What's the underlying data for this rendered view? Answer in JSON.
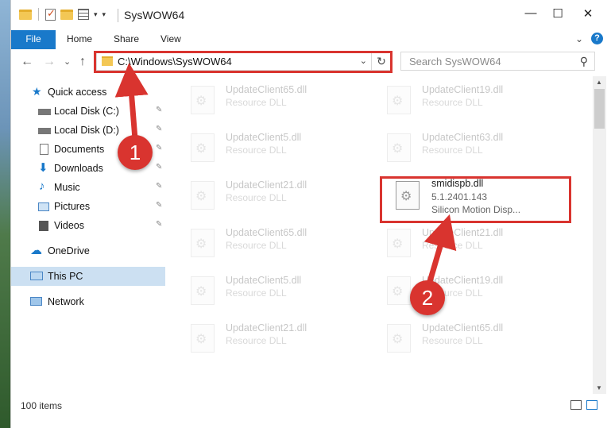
{
  "window": {
    "title": "SysWOW64",
    "controls": {
      "minimize": "—",
      "maximize": "☐",
      "close": "✕"
    }
  },
  "ribbon": {
    "tabs": [
      "File",
      "Home",
      "Share",
      "View"
    ],
    "expand_glyph": "⌄",
    "help_glyph": "?"
  },
  "address": {
    "path": "C:\\Windows\\SysWOW64",
    "dropdown_glyph": "⌄",
    "refresh_glyph": "↻"
  },
  "search": {
    "placeholder": "Search SysWOW64",
    "icon": "search-icon"
  },
  "nav_buttons": {
    "back": "←",
    "forward": "→",
    "recent": "⌄",
    "up": "↑"
  },
  "sidebar": {
    "items": [
      {
        "label": "Quick access",
        "icon": "star-icon",
        "pinned": false
      },
      {
        "label": "Local Disk (C:)",
        "icon": "drive-icon",
        "pinned": true
      },
      {
        "label": "Local Disk (D:)",
        "icon": "drive-icon",
        "pinned": true
      },
      {
        "label": "Documents",
        "icon": "document-icon",
        "pinned": true
      },
      {
        "label": "Downloads",
        "icon": "download-icon",
        "pinned": true
      },
      {
        "label": "Music",
        "icon": "music-icon",
        "pinned": true
      },
      {
        "label": "Pictures",
        "icon": "pictures-icon",
        "pinned": true
      },
      {
        "label": "Videos",
        "icon": "videos-icon",
        "pinned": true
      },
      {
        "label": "OneDrive",
        "icon": "cloud-icon",
        "pinned": false
      },
      {
        "label": "This PC",
        "icon": "pc-icon",
        "pinned": false,
        "selected": true
      },
      {
        "label": "Network",
        "icon": "network-icon",
        "pinned": false
      }
    ],
    "pin_glyph": "📌"
  },
  "files": {
    "left_column": [
      {
        "name": "UpdateClient65.dll",
        "desc": "Resource DLL"
      },
      {
        "name": "UpdateClient5.dll",
        "desc": "Resource DLL"
      },
      {
        "name": "UpdateClient21.dll",
        "desc": "Resource DLL"
      },
      {
        "name": "UpdateClient65.dll",
        "desc": "Resource DLL"
      },
      {
        "name": "UpdateClient5.dll",
        "desc": "Resource DLL"
      },
      {
        "name": "UpdateClient21.dll",
        "desc": "Resource DLL"
      }
    ],
    "right_column": [
      {
        "name": "UpdateClient19.dll",
        "desc": "Resource DLL"
      },
      {
        "name": "UpdateClient63.dll",
        "desc": "Resource DLL"
      },
      {
        "name": "smidispb.dll",
        "desc": "5.1.2401.143",
        "extra": "Silicon Motion Disp...",
        "highlighted": true
      },
      {
        "name": "UpdateClient21.dll",
        "desc": "Resource DLL"
      },
      {
        "name": "UpdateClient19.dll",
        "desc": "Resource DLL"
      },
      {
        "name": "UpdateClient65.dll",
        "desc": "Resource DLL"
      }
    ]
  },
  "status": {
    "item_count": "100 items"
  },
  "annotations": {
    "step1": "1",
    "step2": "2",
    "color": "#d9342f"
  }
}
